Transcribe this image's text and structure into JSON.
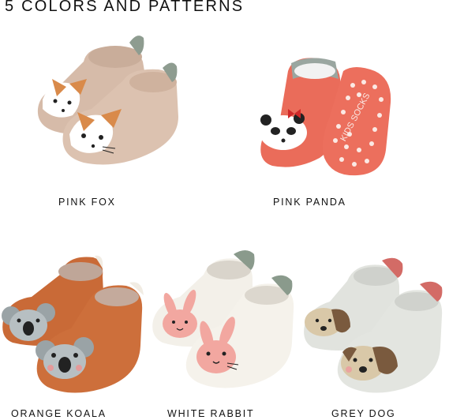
{
  "headline": "5 COLORS AND PATTERNS",
  "products": {
    "fox": {
      "label": "PINK FOX",
      "icon": "fox-face-icon"
    },
    "panda": {
      "label": "PINK PANDA",
      "icon": "panda-face-icon",
      "sole_text": "KIDS SOCKS"
    },
    "koala": {
      "label": "ORANGE KOALA",
      "icon": "koala-face-icon"
    },
    "rabbit": {
      "label": "WHITE RABBIT",
      "icon": "rabbit-face-icon"
    },
    "dog": {
      "label": "GREY DOG",
      "icon": "dog-face-icon"
    }
  },
  "colors": {
    "fox_knit": "#d9bfae",
    "panda_knit": "#ec6f5d",
    "koala_knit": "#c96a37",
    "rabbit_knit": "#f4f1ea",
    "dog_knit": "#e2e4df",
    "heel_accent": "#8a9a8c"
  }
}
